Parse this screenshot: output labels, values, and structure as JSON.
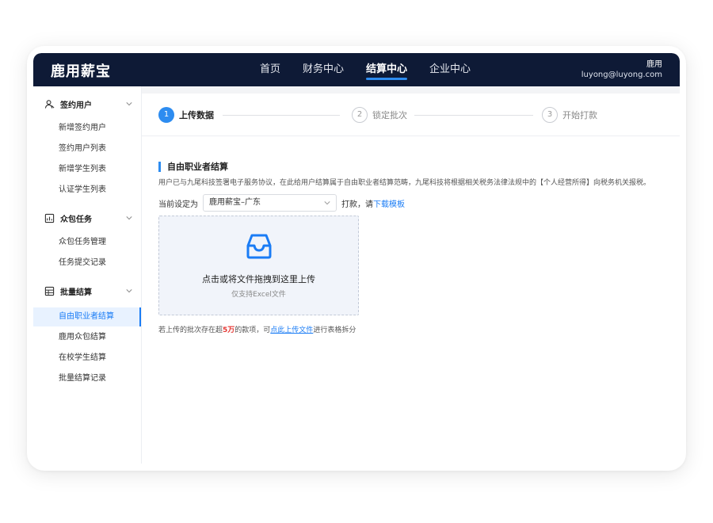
{
  "header": {
    "brand": "鹿用薪宝",
    "nav": [
      "首页",
      "财务中心",
      "结算中心",
      "企业中心"
    ],
    "active_nav": 2,
    "user_name": "鹿用",
    "user_email": "luyong@luyong.com"
  },
  "sidebar": {
    "groups": [
      {
        "title": "签约用户",
        "items": [
          "新增签约用户",
          "签约用户列表",
          "新增学生列表",
          "认证学生列表"
        ]
      },
      {
        "title": "众包任务",
        "items": [
          "众包任务管理",
          "任务提交记录"
        ]
      },
      {
        "title": "批量结算",
        "items": [
          "自由职业者结算",
          "鹿用众包结算",
          "在校学生结算",
          "批量结算记录"
        ]
      }
    ],
    "active_item": "自由职业者结算"
  },
  "steps": [
    {
      "num": "1",
      "label": "上传数据",
      "active": true
    },
    {
      "num": "2",
      "label": "锁定批次",
      "active": false
    },
    {
      "num": "3",
      "label": "开始打款",
      "active": false
    }
  ],
  "section": {
    "title": "自由职业者结算",
    "desc": "用户已与九尾科技签署电子服务协议，在此给用户结算属于自由职业者结算范畴，九尾科技将根据相关税务法律法规中的【个人经营所得】向税务机关报税。"
  },
  "setting": {
    "label": "当前设定为",
    "selected": "鹿用薪宝–广东",
    "after_text": "打款，请",
    "download_link": "下载模板"
  },
  "upload": {
    "title": "点击或将文件拖拽到这里上传",
    "hint": "仅支持Excel文件"
  },
  "note": {
    "prefix": "若上传的批次存在超",
    "highlight": "5万",
    "middle": "的款项，可",
    "link": "点此上传文件",
    "suffix": "进行表格拆分"
  },
  "colors": {
    "header_bg": "#0e1a36",
    "accent": "#2d8cf0",
    "link": "#1a7cf5",
    "warn": "#e53935"
  }
}
